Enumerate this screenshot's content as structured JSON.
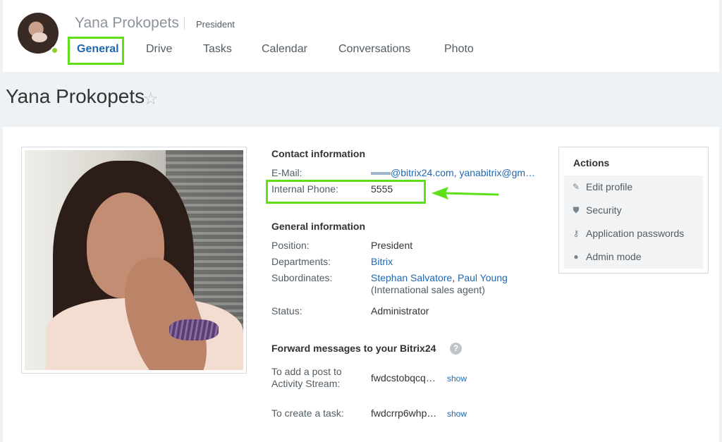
{
  "header": {
    "user_name": "Yana Prokopets",
    "user_role": "President",
    "tabs": [
      {
        "label": "General"
      },
      {
        "label": "Drive"
      },
      {
        "label": "Tasks"
      },
      {
        "label": "Calendar"
      },
      {
        "label": "Conversations"
      },
      {
        "label": "Photo"
      }
    ],
    "active_tab": "General"
  },
  "page": {
    "title": "Yana Prokopets",
    "star_icon": "☆"
  },
  "contact": {
    "section_title": "Contact information",
    "email_label": "E-Mail:",
    "email_value": "@bitrix24.com, yanabitrix@gm…",
    "phone_label": "Internal Phone:",
    "phone_value": "5555"
  },
  "general": {
    "section_title": "General information",
    "position_label": "Position:",
    "position_value": "President",
    "departments_label": "Departments:",
    "departments_value": "Bitrix",
    "subordinates_label": "Subordinates:",
    "subordinate_1": "Stephan Salvatore",
    "subordinate_sep": ",",
    "subordinate_2": "Paul Young",
    "subordinate_note": "(International sales agent)",
    "status_label": "Status:",
    "status_value": "Administrator"
  },
  "forward": {
    "section_title": "Forward messages to your Bitrix24",
    "help_icon": "?",
    "post_label": "To add a post to Activity Stream:",
    "post_value": "fwdcstobqcq…",
    "task_label": "To create a task:",
    "task_value": "fwdcrrp6whp…",
    "show_label": "show"
  },
  "actions": {
    "title": "Actions",
    "items": [
      {
        "label": "Edit profile",
        "icon": "pencil-icon"
      },
      {
        "label": "Security",
        "icon": "shield-icon"
      },
      {
        "label": "Application passwords",
        "icon": "key-icon"
      },
      {
        "label": "Admin mode",
        "icon": "person-icon"
      }
    ]
  },
  "colors": {
    "link": "#2067b0",
    "highlight": "#5ee018",
    "online": "#8ad12c"
  }
}
